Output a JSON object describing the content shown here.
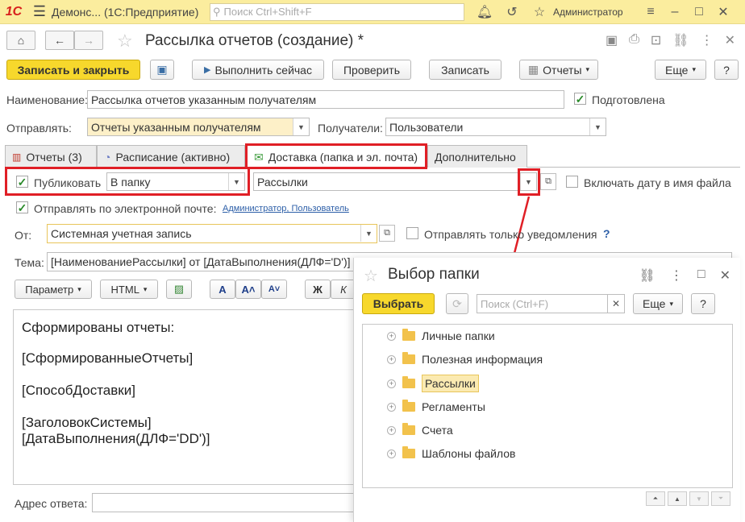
{
  "app": {
    "logo": "1С",
    "title": "Демонс... (1С:Предприятие)",
    "search_placeholder": "Поиск Ctrl+Shift+F",
    "user": "Администратор"
  },
  "form": {
    "title": "Рассылка отчетов (создание) *"
  },
  "toolbar": {
    "save_close": "Записать и закрыть",
    "run_now": "Выполнить сейчас",
    "check": "Проверить",
    "save": "Записать",
    "reports": "Отчеты",
    "more": "Еще",
    "help": "?"
  },
  "fields": {
    "name_label": "Наименование:",
    "name_value": "Рассылка отчетов указанным получателям",
    "prepared_label": "Подготовлена",
    "prepared_checked": true,
    "send_label": "Отправлять:",
    "send_value": "Отчеты указанным получателям",
    "recipients_label": "Получатели:",
    "recipients_value": "Пользователи"
  },
  "tabs": [
    {
      "label": "Отчеты (3)"
    },
    {
      "label": "Расписание (активно)"
    },
    {
      "label": "Доставка (папка и эл. почта)"
    },
    {
      "label": "Дополнительно"
    }
  ],
  "delivery": {
    "publish_label": "Публиковать",
    "publish_checked": true,
    "publish_mode": "В папку",
    "folder_value": "Рассылки",
    "include_date_label": "Включать дату в имя файла",
    "include_date_checked": false,
    "email_label": "Отправлять по электронной почте:",
    "email_checked": true,
    "email_recipients_link": "Администратор, Пользователь",
    "from_label": "От:",
    "from_value": "Системная учетная запись",
    "notify_only_label": "Отправлять только уведомления",
    "notify_help": "?",
    "subject_label": "Тема:",
    "subject_value": "[НаименованиеРассылки] от [ДатаВыполнения(ДЛФ='D')]",
    "param_button": "Параметр",
    "html_button": "HTML",
    "bold_button": "Ж",
    "italic_button": "К",
    "font_a": "A",
    "reply_label": "Адрес ответа:"
  },
  "editor_lines": [
    "Сформированы отчеты:",
    "[СформированныеОтчеты]",
    "[СпособДоставки]",
    "[ЗаголовокСистемы]",
    "[ДатаВыполнения(ДЛФ='DD')]"
  ],
  "dialog": {
    "title": "Выбор папки",
    "select_button": "Выбрать",
    "search_placeholder": "Поиск (Ctrl+F)",
    "more": "Еще",
    "help": "?",
    "folders": [
      {
        "label": "Личные папки",
        "selected": false
      },
      {
        "label": "Полезная информация",
        "selected": false
      },
      {
        "label": "Рассылки",
        "selected": true
      },
      {
        "label": "Регламенты",
        "selected": false
      },
      {
        "label": "Счета",
        "selected": false
      },
      {
        "label": "Шаблоны файлов",
        "selected": false
      }
    ]
  },
  "colors": {
    "appbar": "#fbed9e",
    "primary_button": "#f7d82c",
    "highlight": "#e01f26",
    "field_yellow": "#fdf0c8"
  }
}
